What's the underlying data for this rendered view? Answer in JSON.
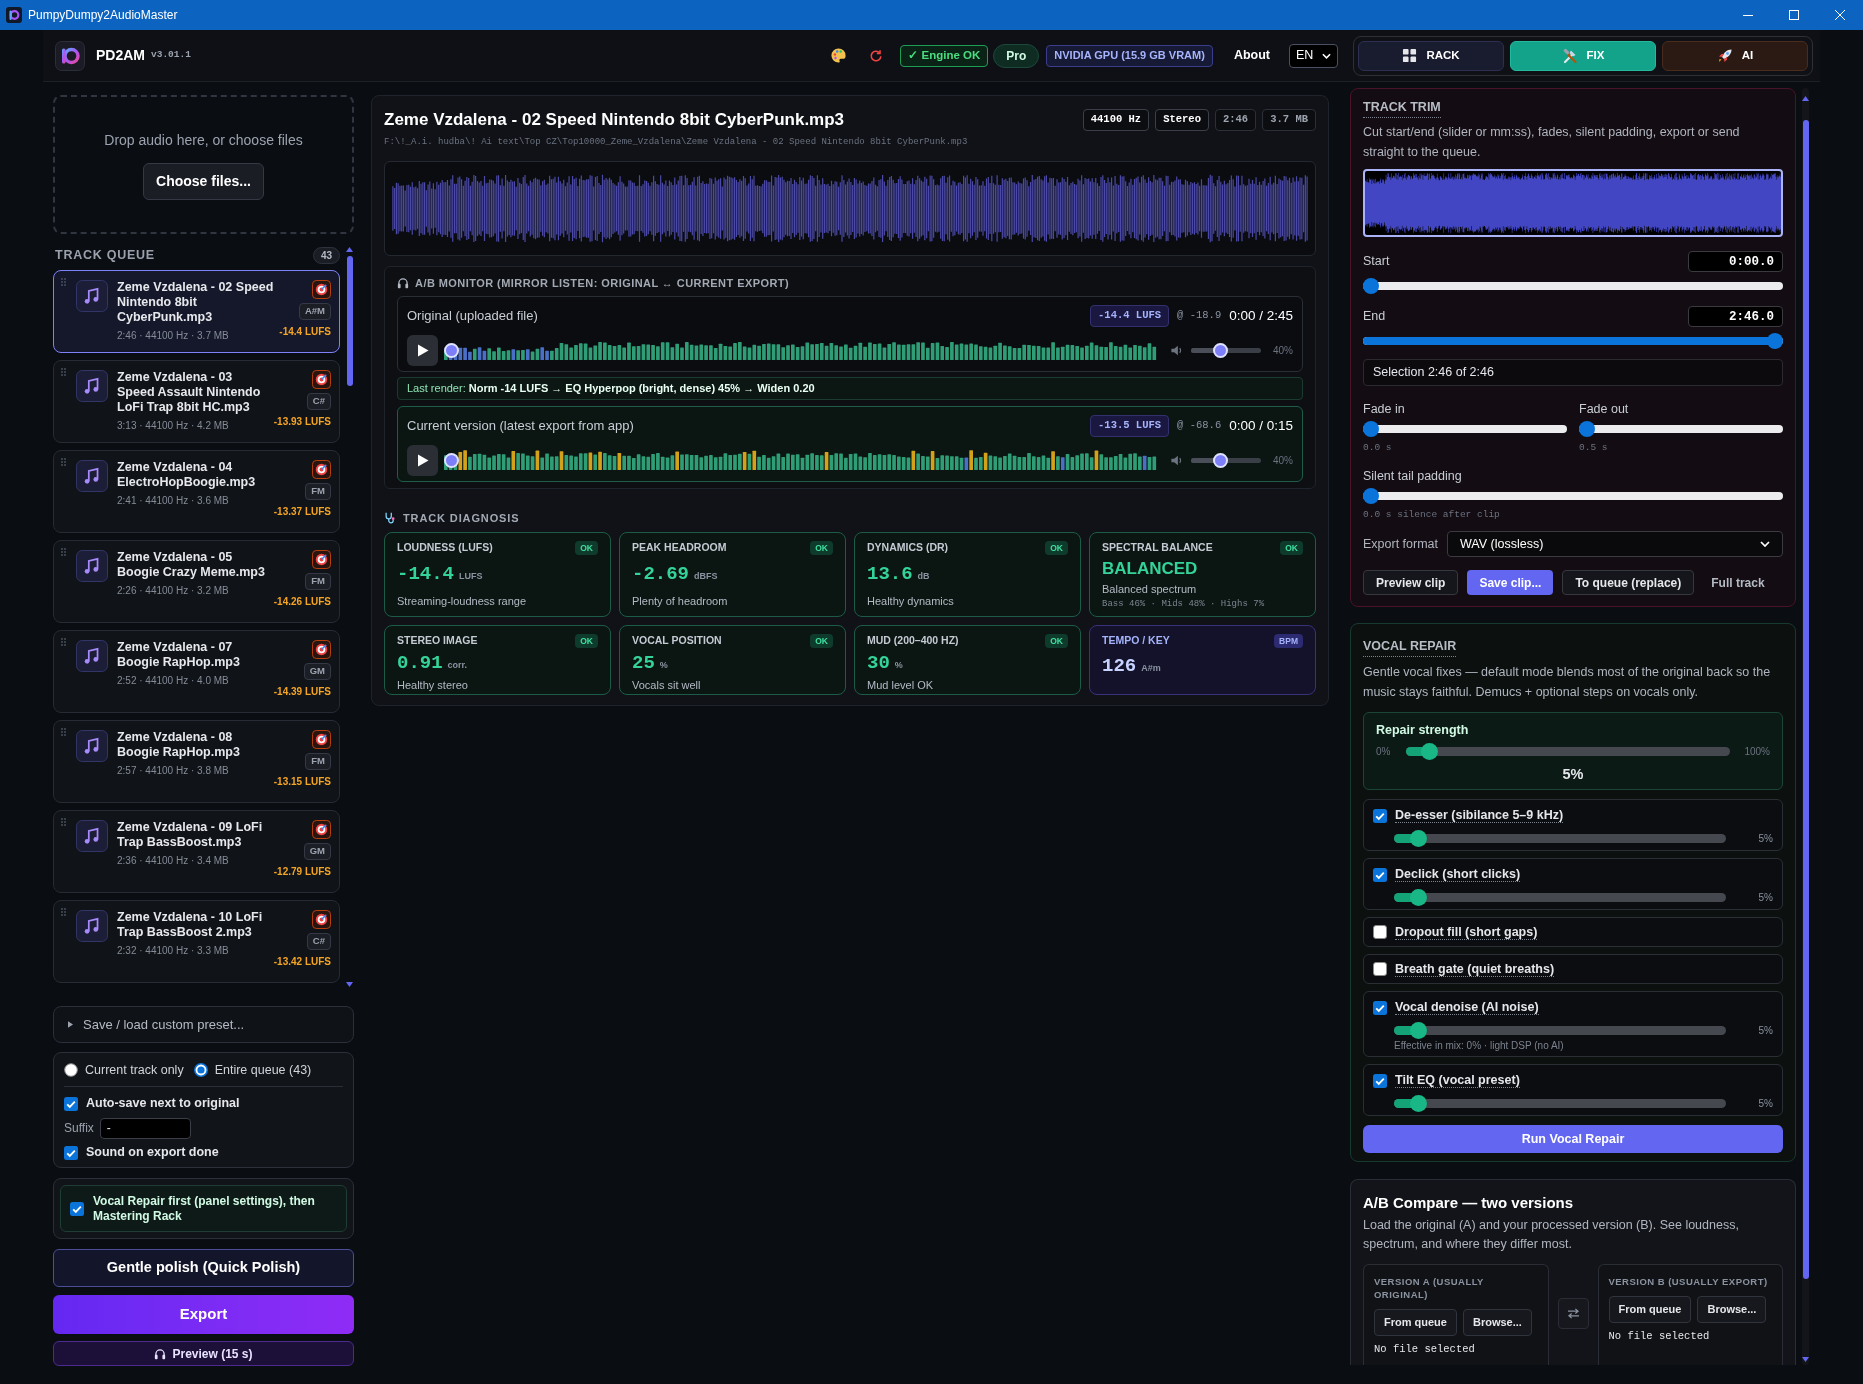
{
  "window": {
    "title": "PumpyDumpy2AudioMaster"
  },
  "header": {
    "app_name": "PD2AM",
    "version": "v3.01.1",
    "engine_status": "✓ Engine OK",
    "plan": "Pro",
    "gpu": "NVIDIA GPU (15.9 GB VRAM)",
    "about": "About",
    "language": "EN",
    "modes": [
      {
        "label": "RACK",
        "kind": "rack",
        "selected": false
      },
      {
        "label": "FIX",
        "kind": "fix",
        "selected": true
      },
      {
        "label": "AI",
        "kind": "ai",
        "selected": false
      }
    ]
  },
  "upload": {
    "hint": "Drop audio here, or choose files",
    "button": "Choose files..."
  },
  "queue": {
    "title": "TRACK QUEUE",
    "count": "43",
    "tracks": [
      {
        "name": "Zeme Vzdalena - 02 Speed Nintendo 8bit CyberPunk.mp3",
        "meta": "2:46 · 44100 Hz · 3.7 MB",
        "key": "A#M",
        "loudness": "-14.4 LUFS",
        "selected": true
      },
      {
        "name": "Zeme Vzdalena - 03 Speed Assault Nintendo LoFi Trap 8bit HC.mp3",
        "meta": "3:13 · 44100 Hz · 4.2 MB",
        "key": "C#",
        "loudness": "-13.93 LUFS",
        "selected": false
      },
      {
        "name": "Zeme Vzdalena - 04 ElectroHopBoogie.mp3",
        "meta": "2:41 · 44100 Hz · 3.6 MB",
        "key": "FM",
        "loudness": "-13.37 LUFS",
        "selected": false
      },
      {
        "name": "Zeme Vzdalena - 05 Boogie Crazy Meme.mp3",
        "meta": "2:26 · 44100 Hz · 3.2 MB",
        "key": "FM",
        "loudness": "-14.26 LUFS",
        "selected": false
      },
      {
        "name": "Zeme Vzdalena - 07 Boogie RapHop.mp3",
        "meta": "2:52 · 44100 Hz · 4.0 MB",
        "key": "GM",
        "loudness": "-14.39 LUFS",
        "selected": false
      },
      {
        "name": "Zeme Vzdalena - 08 Boogie RapHop.mp3",
        "meta": "2:57 · 44100 Hz · 3.8 MB",
        "key": "FM",
        "loudness": "-13.15 LUFS",
        "selected": false
      },
      {
        "name": "Zeme Vzdalena - 09 LoFi Trap BassBoost.mp3",
        "meta": "2:36 · 44100 Hz · 3.4 MB",
        "key": "GM",
        "loudness": "-12.79 LUFS",
        "selected": false
      },
      {
        "name": "Zeme Vzdalena - 10 LoFi Trap BassBoost 2.mp3",
        "meta": "2:32 · 44100 Hz · 3.3 MB",
        "key": "C#",
        "loudness": "-13.42 LUFS",
        "selected": false
      }
    ]
  },
  "preset": {
    "label": "Save / load custom preset..."
  },
  "export_options": {
    "scope": [
      {
        "label": "Current track only",
        "selected": false
      },
      {
        "label": "Entire queue (43)",
        "selected": true
      }
    ],
    "auto_save": {
      "label": "Auto-save next to original",
      "checked": true
    },
    "suffix": {
      "label": "Suffix",
      "value": "-"
    },
    "sound": {
      "label": "Sound on export done",
      "checked": true
    }
  },
  "vocal_first": {
    "label": "Vocal Repair first (panel settings), then Mastering Rack",
    "checked": true
  },
  "actions": {
    "polish": "Gentle polish (Quick Polish)",
    "export": "Export",
    "preview": "Preview (15 s)"
  },
  "file": {
    "title": "Zeme Vzdalena - 02 Speed Nintendo 8bit CyberPunk.mp3",
    "badges": [
      {
        "text": "44100 Hz",
        "emphasis": true
      },
      {
        "text": "Stereo",
        "emphasis": true
      },
      {
        "text": "2:46",
        "emphasis": false
      },
      {
        "text": "3.7 MB",
        "emphasis": false
      }
    ],
    "path": "F:\\!_A.i. hudba\\! Ai text\\Top CZ\\Top10000_Zeme_Vzdalena\\Zeme Vzdalena - 02 Speed Nintendo 8bit CyberPunk.mp3"
  },
  "monitor": {
    "title": "A/B MONITOR (MIRROR LISTEN: ORIGINAL ↔ CURRENT EXPORT)",
    "original_player": {
      "label": "Original (uploaded file)",
      "loudness": "-14.4 LUFS",
      "peak": "@ -18.9",
      "time": "0:00 / 2:45",
      "seek": {
        "level": 0
      },
      "volume": {
        "level": 0.4,
        "reading": "40%"
      }
    },
    "last_render": "Last render: **Norm -14 LUFS → EQ Hyperpop (bright, dense) 45% → Widen 0.20**",
    "current_player": {
      "label": "Current version (latest export from app)",
      "loudness": "-13.5 LUFS",
      "peak": "@ -68.6",
      "time": "0:00 / 0:15",
      "seek": {
        "level": 0
      },
      "volume": {
        "level": 0.4,
        "reading": "40%"
      }
    }
  },
  "diagnosis": {
    "title": "TRACK DIAGNOSIS",
    "cards": [
      {
        "kind": "metric",
        "label": "LOUDNESS (LUFS)",
        "badge": "OK",
        "value": "-14.4",
        "unit": "LUFS",
        "note": "Streaming-loudness range"
      },
      {
        "kind": "metric",
        "label": "PEAK HEADROOM",
        "badge": "OK",
        "value": "-2.69",
        "unit": "dBFS",
        "note": "Plenty of headroom"
      },
      {
        "kind": "metric",
        "label": "DYNAMICS (DR)",
        "badge": "OK",
        "value": "13.6",
        "unit": "dB",
        "note": "Healthy dynamics"
      },
      {
        "kind": "verdict",
        "label": "SPECTRAL BALANCE",
        "badge": "OK",
        "value": "BALANCED",
        "note": "Balanced spectrum",
        "detail": "Bass 46% · Mids 48% · Highs 7%"
      },
      {
        "kind": "metric",
        "label": "STEREO IMAGE",
        "badge": "OK",
        "value": "0.91",
        "unit": "corr.",
        "note": "Healthy stereo"
      },
      {
        "kind": "metric",
        "label": "VOCAL POSITION",
        "badge": "OK",
        "value": "25",
        "unit": "%",
        "note": "Vocals sit well"
      },
      {
        "kind": "metric",
        "label": "MUD (200–400 HZ)",
        "badge": "OK",
        "value": "30",
        "unit": "%",
        "note": "Mud level OK"
      },
      {
        "kind": "tempo",
        "label": "TEMPO / KEY",
        "badge": "BPM",
        "value": "126",
        "unit": "A#m"
      }
    ]
  },
  "trim": {
    "title": "TRACK TRIM",
    "description": "Cut start/end (slider or mm:ss), fades, silent padding, export or send straight to the queue.",
    "start": {
      "label": "Start",
      "value": "0:00.0",
      "level": 0
    },
    "end": {
      "label": "End",
      "value": "2:46.0",
      "level": 1
    },
    "selection": "Selection 2:46 of 2:46",
    "fades": [
      {
        "label": "Fade in",
        "level": 0,
        "reading": "0.0 s"
      },
      {
        "label": "Fade out",
        "level": 0,
        "reading": "0.5 s"
      }
    ],
    "tail_padding": {
      "label": "Silent tail padding",
      "level": 0,
      "reading": "0.0 s silence after clip"
    },
    "format": {
      "label": "Export format",
      "value": "WAV (lossless)"
    },
    "buttons": [
      {
        "label": "Preview clip",
        "kind": "secondary"
      },
      {
        "label": "Save clip...",
        "kind": "primary"
      },
      {
        "label": "To queue (replace)",
        "kind": "secondary"
      },
      {
        "label": "Full track",
        "kind": "link"
      }
    ]
  },
  "vocal_repair": {
    "title": "VOCAL REPAIR",
    "description": "Gentle vocal fixes — default mode blends most of the original back so the music stays faithful. Demucs + optional steps on vocals only.",
    "strength": {
      "label": "Repair strength",
      "min": "0%",
      "max": "100%",
      "level": 0.05,
      "value": "5%"
    },
    "options": [
      {
        "label": "De-esser (sibilance 5–9 kHz)",
        "checked": true,
        "level": 0.05,
        "reading": "5%"
      },
      {
        "label": "Declick (short clicks)",
        "checked": true,
        "level": 0.05,
        "reading": "5%"
      },
      {
        "label": "Dropout fill (short gaps)",
        "checked": false
      },
      {
        "label": "Breath gate (quiet breaths)",
        "checked": false
      },
      {
        "label": "Vocal denoise (AI noise)",
        "checked": true,
        "level": 0.05,
        "reading": "5%",
        "note": "Effective in mix: 0% · light DSP (no AI)"
      },
      {
        "label": "Tilt EQ (vocal preset)",
        "checked": true,
        "level": 0.05,
        "reading": "5%"
      }
    ],
    "button": "Run Vocal Repair"
  },
  "compare": {
    "title": "A/B Compare — two versions",
    "description": "Load the original (A) and your processed version (B). See loudness, spectrum, and where they differ most.",
    "versions": [
      {
        "title": "VERSION A (USUALLY ORIGINAL)",
        "buttons": [
          "From queue",
          "Browse..."
        ],
        "status": "No file selected"
      },
      {
        "title": "VERSION B (USUALLY EXPORT)",
        "buttons": [
          "From queue",
          "Browse..."
        ],
        "status": "No file selected"
      }
    ]
  }
}
